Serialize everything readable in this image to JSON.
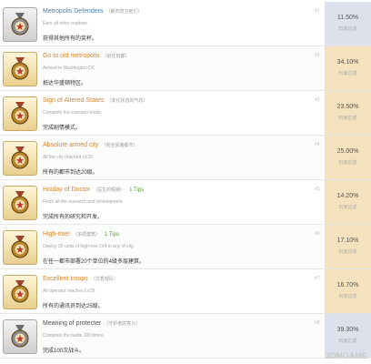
{
  "pct_label": "玩家达成",
  "watermark": "3DMGAME",
  "achievements": [
    {
      "num": "#1",
      "title": "Metropolis Defenders",
      "sub": "（都市防卫者们）",
      "desc": "Earn all other trophies.",
      "cn": "获得其他所有的奖杯。",
      "pct": "11.50%",
      "style": "blue",
      "tier": "silver",
      "color": "blue"
    },
    {
      "num": "#2",
      "title": "Go to old metropolis",
      "sub": "（前往旧都）",
      "desc": "Arrived in Washington DC.",
      "cn": "抵达华盛顿特区。",
      "pct": "34.10%",
      "style": "gold",
      "tier": "gold",
      "color": "orange"
    },
    {
      "num": "#3",
      "title": "Sign of Altered States",
      "sub": "（变化状态的气息）",
      "desc": "Complete the scenario mode.",
      "cn": "完成剧情模式。",
      "pct": "23.50%",
      "style": "gold",
      "tier": "gold",
      "color": "orange"
    },
    {
      "num": "#4",
      "title": "Absolute armed city",
      "sub": "（完全武装都市）",
      "desc": "All the city reached LV20.",
      "cn": "所有的都市到达20级。",
      "pct": "25.00%",
      "style": "gold",
      "tier": "gold",
      "color": "orange"
    },
    {
      "num": "#5",
      "title": "Hoiday of Doctor",
      "sub": "（医生的假期）",
      "tips": "1 Tips",
      "desc": "Finsh all the research and development.",
      "cn": "完成所有的研究和开发。",
      "pct": "14.20%",
      "style": "gold",
      "tier": "gold",
      "color": "orange"
    },
    {
      "num": "#6",
      "title": "High-rise!",
      "sub": "（多层建筑）",
      "tips": "1 Tips",
      "desc": "Deploy 20 units of high-rise LV4 in any of city.",
      "cn": "在任一都市部署20个单位的4级多层建筑。",
      "pct": "17.10%",
      "style": "gold",
      "tier": "gold",
      "color": "orange"
    },
    {
      "num": "#7",
      "title": "Excellent troops",
      "sub": "（优秀部队）",
      "desc": "All operator reaches LV25.",
      "cn": "所有的通讯员到达25级。",
      "pct": "16.70%",
      "style": "gold",
      "tier": "gold",
      "color": "orange"
    },
    {
      "num": "#8",
      "title": "Meaning of protecter",
      "sub": "（守护者的意义）",
      "desc": "Complete the battle 100 times.",
      "cn": "完成100次战斗。",
      "pct": "39.30%",
      "style": "blue",
      "tier": "silver",
      "color": "plain"
    }
  ]
}
